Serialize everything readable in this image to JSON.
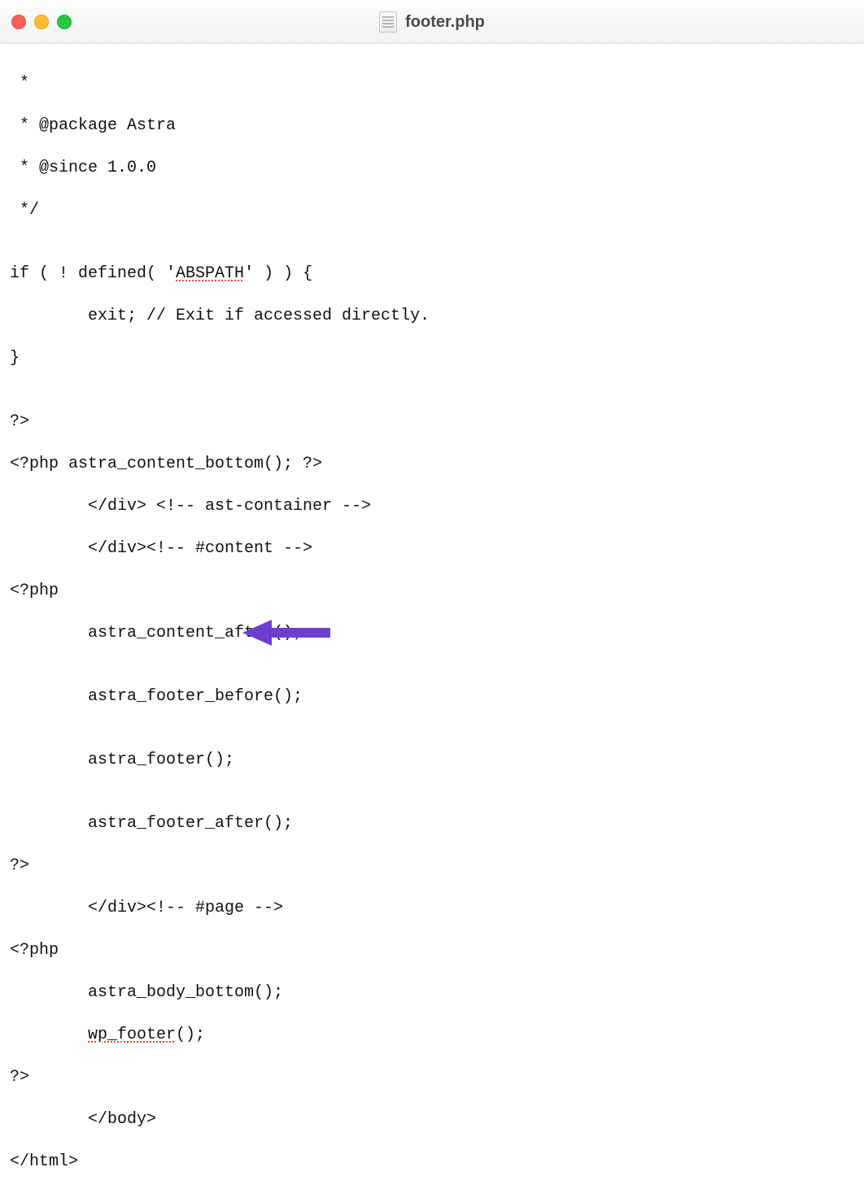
{
  "window": {
    "title": "footer.php",
    "traffic": {
      "close": "close",
      "min": "minimize",
      "max": "zoom"
    }
  },
  "code": {
    "l01": " *",
    "l02": " * @package Astra",
    "l03": " * @since 1.0.0",
    "l04": " */",
    "l05": "",
    "l06a": "if ( ! defined( '",
    "l06b": "ABSPATH",
    "l06c": "' ) ) {",
    "l07": "exit; // Exit if accessed directly.",
    "l08": "}",
    "l09": "",
    "l10": "?>",
    "l11": "<?php astra_content_bottom(); ?>",
    "l12": "</div> <!-- ast-container -->",
    "l13": "</div><!-- #content -->",
    "l14": "<?php",
    "l15": "astra_content_after();",
    "l16": "",
    "l17": "astra_footer_before();",
    "l18": "",
    "l19": "astra_footer();",
    "l20": "",
    "l21": "astra_footer_after();",
    "l22": "?>",
    "l23": "</div><!-- #page -->",
    "l24": "<?php",
    "l25": "astra_body_bottom();",
    "l26a": "wp_footer",
    "l26b": "();",
    "l27": "?>",
    "l28": "</body>",
    "l29": "</html>"
  },
  "annotation": {
    "arrow_color": "#6c3fd1",
    "arrow_target": "wp_footer();"
  }
}
